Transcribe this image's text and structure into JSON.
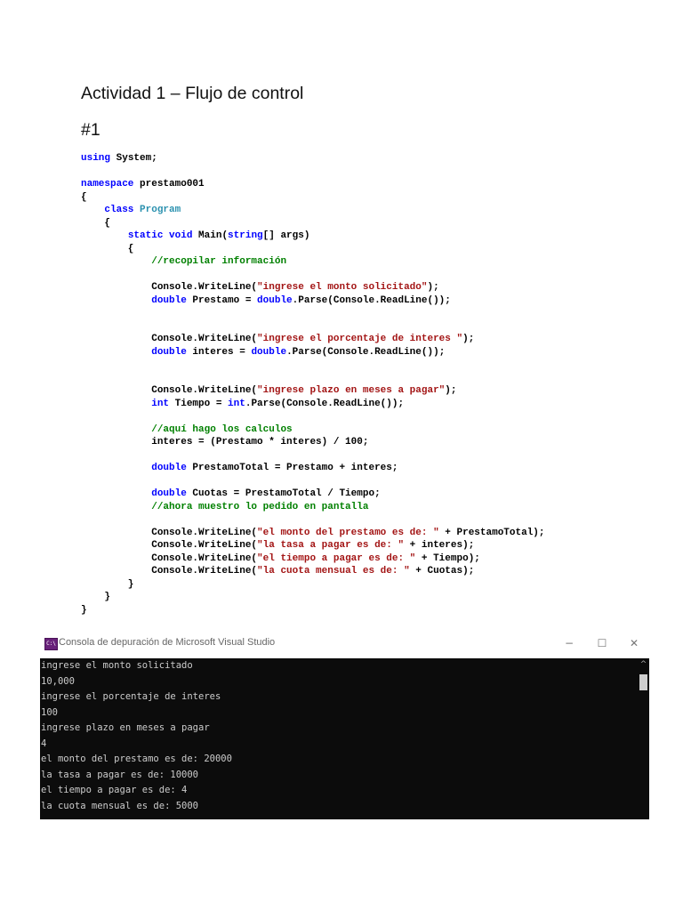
{
  "document": {
    "title": "Actividad 1 – Flujo de control",
    "subtitle": "#1"
  },
  "code": {
    "lines": [
      [
        {
          "t": "using",
          "c": "kw"
        },
        {
          "t": " System;"
        }
      ],
      [],
      [
        {
          "t": "namespace",
          "c": "kw"
        },
        {
          "t": " prestamo001"
        }
      ],
      [
        {
          "t": "{"
        }
      ],
      [
        {
          "t": "    "
        },
        {
          "t": "class",
          "c": "kw"
        },
        {
          "t": " "
        },
        {
          "t": "Program",
          "c": "ty"
        }
      ],
      [
        {
          "t": "    {"
        }
      ],
      [
        {
          "t": "        "
        },
        {
          "t": "static",
          "c": "kw"
        },
        {
          "t": " "
        },
        {
          "t": "void",
          "c": "kw"
        },
        {
          "t": " Main("
        },
        {
          "t": "string",
          "c": "kw"
        },
        {
          "t": "[] args)"
        }
      ],
      [
        {
          "t": "        {"
        }
      ],
      [
        {
          "t": "            "
        },
        {
          "t": "//recopilar información",
          "c": "cm"
        }
      ],
      [],
      [
        {
          "t": "            Console.WriteLine("
        },
        {
          "t": "\"ingrese el monto solicitado\"",
          "c": "str"
        },
        {
          "t": ");"
        }
      ],
      [
        {
          "t": "            "
        },
        {
          "t": "double",
          "c": "kw"
        },
        {
          "t": " Prestamo = "
        },
        {
          "t": "double",
          "c": "kw"
        },
        {
          "t": ".Parse(Console.ReadLine());"
        }
      ],
      [],
      [],
      [
        {
          "t": "            Console.WriteLine("
        },
        {
          "t": "\"ingrese el porcentaje de interes \"",
          "c": "str"
        },
        {
          "t": ");"
        }
      ],
      [
        {
          "t": "            "
        },
        {
          "t": "double",
          "c": "kw"
        },
        {
          "t": " interes = "
        },
        {
          "t": "double",
          "c": "kw"
        },
        {
          "t": ".Parse(Console.ReadLine());"
        }
      ],
      [],
      [],
      [
        {
          "t": "            Console.WriteLine("
        },
        {
          "t": "\"ingrese plazo en meses a pagar\"",
          "c": "str"
        },
        {
          "t": ");"
        }
      ],
      [
        {
          "t": "            "
        },
        {
          "t": "int",
          "c": "kw"
        },
        {
          "t": " Tiempo = "
        },
        {
          "t": "int",
          "c": "kw"
        },
        {
          "t": ".Parse(Console.ReadLine());"
        }
      ],
      [],
      [
        {
          "t": "            "
        },
        {
          "t": "//aquí hago los calculos",
          "c": "cm"
        }
      ],
      [
        {
          "t": "            interes = (Prestamo * interes) / 100;"
        }
      ],
      [],
      [
        {
          "t": "            "
        },
        {
          "t": "double",
          "c": "kw"
        },
        {
          "t": " PrestamoTotal = Prestamo + interes;"
        }
      ],
      [],
      [
        {
          "t": "            "
        },
        {
          "t": "double",
          "c": "kw"
        },
        {
          "t": " Cuotas = PrestamoTotal / Tiempo;"
        }
      ],
      [
        {
          "t": "            "
        },
        {
          "t": "//ahora muestro lo pedido en pantalla",
          "c": "cm"
        }
      ],
      [],
      [
        {
          "t": "            Console.WriteLine("
        },
        {
          "t": "\"el monto del prestamo es de: \"",
          "c": "str"
        },
        {
          "t": " + PrestamoTotal);"
        }
      ],
      [
        {
          "t": "            Console.WriteLine("
        },
        {
          "t": "\"la tasa a pagar es de: \"",
          "c": "str"
        },
        {
          "t": " + interes);"
        }
      ],
      [
        {
          "t": "            Console.WriteLine("
        },
        {
          "t": "\"el tiempo a pagar es de: \"",
          "c": "str"
        },
        {
          "t": " + Tiempo);"
        }
      ],
      [
        {
          "t": "            Console.WriteLine("
        },
        {
          "t": "\"la cuota mensual es de: \"",
          "c": "str"
        },
        {
          "t": " + Cuotas);"
        }
      ],
      [
        {
          "t": "        }"
        }
      ],
      [
        {
          "t": "    }"
        }
      ],
      [
        {
          "t": "}"
        }
      ]
    ]
  },
  "console": {
    "window_title": "Consola de depuración de Microsoft Visual Studio",
    "icon_text": "C:\\",
    "minimize_icon": "minimize-icon",
    "maximize_icon": "maximize-icon",
    "close_icon": "close-icon",
    "minimize_glyph": "−",
    "maximize_glyph": "☐",
    "close_glyph": "✕",
    "scroll_up_glyph": "^",
    "output_lines": [
      "ingrese el monto solicitado",
      "10,000",
      "ingrese el porcentaje de interes",
      "100",
      "ingrese plazo en meses a pagar",
      "4",
      "el monto del prestamo es de: 20000",
      "la tasa a pagar es de: 10000",
      "el tiempo a pagar es de: 4",
      "la cuota mensual es de: 5000"
    ]
  },
  "colors": {
    "keyword": "#0000ff",
    "type": "#2b91af",
    "string": "#a31515",
    "comment": "#008000",
    "console_bg": "#0c0c0c",
    "console_text": "#cccccc"
  }
}
